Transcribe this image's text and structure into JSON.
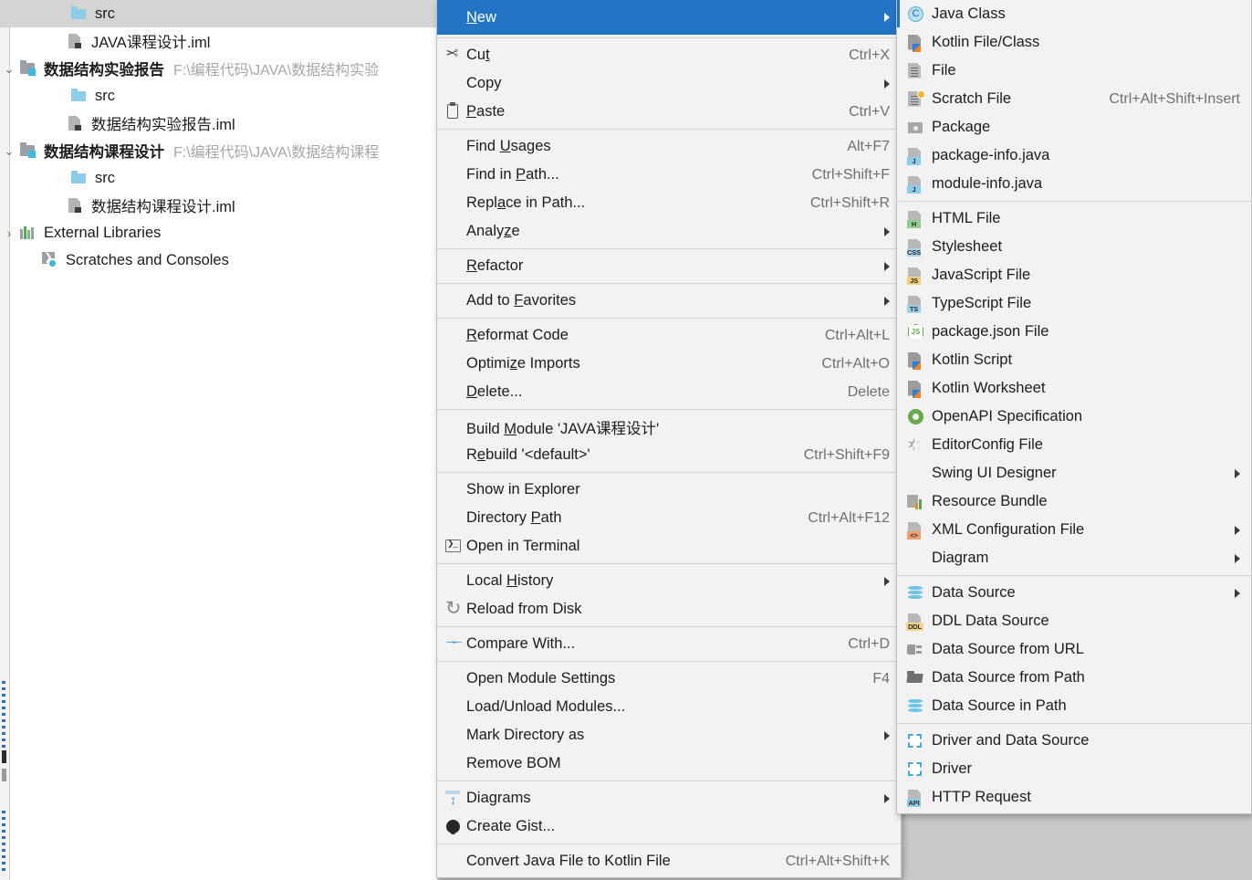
{
  "tree": {
    "rows": [
      {
        "arrow": "",
        "icon": "folder",
        "label": "src",
        "bold": false,
        "path": "",
        "selected": true,
        "indent": 76
      },
      {
        "arrow": "",
        "icon": "iml",
        "label": "JAVA课程设计.iml",
        "bold": false,
        "path": "",
        "selected": false,
        "indent": 72
      },
      {
        "arrow": "⌄",
        "icon": "module",
        "label": "数据结构实验报告",
        "bold": true,
        "path": "F:\\编程代码\\JAVA\\数据结构实验",
        "selected": false,
        "indent": 20
      },
      {
        "arrow": "",
        "icon": "folder",
        "label": "src",
        "bold": false,
        "path": "",
        "selected": false,
        "indent": 76
      },
      {
        "arrow": "",
        "icon": "iml",
        "label": "数据结构实验报告.iml",
        "bold": false,
        "path": "",
        "selected": false,
        "indent": 72
      },
      {
        "arrow": "⌄",
        "icon": "module",
        "label": "数据结构课程设计",
        "bold": true,
        "path": "F:\\编程代码\\JAVA\\数据结构课程",
        "selected": false,
        "indent": 20
      },
      {
        "arrow": "",
        "icon": "folder",
        "label": "src",
        "bold": false,
        "path": "",
        "selected": false,
        "indent": 76
      },
      {
        "arrow": "",
        "icon": "iml",
        "label": "数据结构课程设计.iml",
        "bold": false,
        "path": "",
        "selected": false,
        "indent": 72
      },
      {
        "arrow": "›",
        "icon": "libs",
        "label": "External Libraries",
        "bold": false,
        "path": "",
        "selected": false,
        "indent": 20
      },
      {
        "arrow": "",
        "icon": "scratch",
        "label": "Scratches and Consoles",
        "bold": false,
        "path": "",
        "selected": false,
        "indent": 44
      }
    ]
  },
  "context_menu": {
    "items": [
      {
        "type": "item",
        "icon": "none",
        "label": "New",
        "mnemonic": "N",
        "shortcut": "",
        "submenu": true,
        "highlighted": true
      },
      {
        "type": "sep"
      },
      {
        "type": "item",
        "icon": "cut",
        "label": "Cut",
        "mnemonic": "t",
        "shortcut": "Ctrl+X",
        "submenu": false,
        "highlighted": false
      },
      {
        "type": "item",
        "icon": "none",
        "label": "Copy",
        "mnemonic": "",
        "shortcut": "",
        "submenu": true,
        "highlighted": false
      },
      {
        "type": "item",
        "icon": "paste",
        "label": "Paste",
        "mnemonic": "P",
        "shortcut": "Ctrl+V",
        "submenu": false,
        "highlighted": false
      },
      {
        "type": "sep"
      },
      {
        "type": "item",
        "icon": "none",
        "label": "Find Usages",
        "mnemonic": "U",
        "shortcut": "Alt+F7",
        "submenu": false,
        "highlighted": false
      },
      {
        "type": "item",
        "icon": "none",
        "label": "Find in Path...",
        "mnemonic": "P",
        "shortcut": "Ctrl+Shift+F",
        "submenu": false,
        "highlighted": false
      },
      {
        "type": "item",
        "icon": "none",
        "label": "Replace in Path...",
        "mnemonic": "a",
        "shortcut": "Ctrl+Shift+R",
        "submenu": false,
        "highlighted": false
      },
      {
        "type": "item",
        "icon": "none",
        "label": "Analyze",
        "mnemonic": "z",
        "shortcut": "",
        "submenu": true,
        "highlighted": false
      },
      {
        "type": "sep"
      },
      {
        "type": "item",
        "icon": "none",
        "label": "Refactor",
        "mnemonic": "R",
        "shortcut": "",
        "submenu": true,
        "highlighted": false
      },
      {
        "type": "sep"
      },
      {
        "type": "item",
        "icon": "none",
        "label": "Add to Favorites",
        "mnemonic": "F",
        "shortcut": "",
        "submenu": true,
        "highlighted": false
      },
      {
        "type": "sep"
      },
      {
        "type": "item",
        "icon": "none",
        "label": "Reformat Code",
        "mnemonic": "R",
        "shortcut": "Ctrl+Alt+L",
        "submenu": false,
        "highlighted": false
      },
      {
        "type": "item",
        "icon": "none",
        "label": "Optimize Imports",
        "mnemonic": "z",
        "shortcut": "Ctrl+Alt+O",
        "submenu": false,
        "highlighted": false
      },
      {
        "type": "item",
        "icon": "none",
        "label": "Delete...",
        "mnemonic": "D",
        "shortcut": "Delete",
        "submenu": false,
        "highlighted": false
      },
      {
        "type": "sep"
      },
      {
        "type": "item",
        "icon": "none",
        "label": "Build Module 'JAVA课程设计'",
        "mnemonic": "M",
        "shortcut": "",
        "submenu": false,
        "highlighted": false
      },
      {
        "type": "item",
        "icon": "none",
        "label": "Rebuild '<default>'",
        "mnemonic": "e",
        "shortcut": "Ctrl+Shift+F9",
        "submenu": false,
        "highlighted": false
      },
      {
        "type": "sep"
      },
      {
        "type": "item",
        "icon": "none",
        "label": "Show in Explorer",
        "mnemonic": "",
        "shortcut": "",
        "submenu": false,
        "highlighted": false
      },
      {
        "type": "item",
        "icon": "none",
        "label": "Directory Path",
        "mnemonic": "P",
        "shortcut": "Ctrl+Alt+F12",
        "submenu": false,
        "highlighted": false
      },
      {
        "type": "item",
        "icon": "terminal",
        "label": "Open in Terminal",
        "mnemonic": "",
        "shortcut": "",
        "submenu": false,
        "highlighted": false
      },
      {
        "type": "sep"
      },
      {
        "type": "item",
        "icon": "none",
        "label": "Local History",
        "mnemonic": "H",
        "shortcut": "",
        "submenu": true,
        "highlighted": false
      },
      {
        "type": "item",
        "icon": "reload",
        "label": "Reload from Disk",
        "mnemonic": "",
        "shortcut": "",
        "submenu": false,
        "highlighted": false
      },
      {
        "type": "sep"
      },
      {
        "type": "item",
        "icon": "compare",
        "label": "Compare With...",
        "mnemonic": "",
        "shortcut": "Ctrl+D",
        "submenu": false,
        "highlighted": false
      },
      {
        "type": "sep"
      },
      {
        "type": "item",
        "icon": "none",
        "label": "Open Module Settings",
        "mnemonic": "",
        "shortcut": "F4",
        "submenu": false,
        "highlighted": false
      },
      {
        "type": "item",
        "icon": "none",
        "label": "Load/Unload Modules...",
        "mnemonic": "",
        "shortcut": "",
        "submenu": false,
        "highlighted": false
      },
      {
        "type": "item",
        "icon": "none",
        "label": "Mark Directory as",
        "mnemonic": "",
        "shortcut": "",
        "submenu": true,
        "highlighted": false
      },
      {
        "type": "item",
        "icon": "none",
        "label": "Remove BOM",
        "mnemonic": "",
        "shortcut": "",
        "submenu": false,
        "highlighted": false
      },
      {
        "type": "sep"
      },
      {
        "type": "item",
        "icon": "diagrams",
        "label": "Diagrams",
        "mnemonic": "",
        "shortcut": "",
        "submenu": true,
        "highlighted": false
      },
      {
        "type": "item",
        "icon": "gist",
        "label": "Create Gist...",
        "mnemonic": "",
        "shortcut": "",
        "submenu": false,
        "highlighted": false
      },
      {
        "type": "sep"
      },
      {
        "type": "item",
        "icon": "none",
        "label": "Convert Java File to Kotlin File",
        "mnemonic": "",
        "shortcut": "Ctrl+Alt+Shift+K",
        "submenu": false,
        "highlighted": false
      }
    ]
  },
  "new_submenu": {
    "items": [
      {
        "type": "item",
        "icon": "java-class",
        "label": "Java Class",
        "shortcut": "",
        "submenu": false
      },
      {
        "type": "item",
        "icon": "kotlin-file",
        "label": "Kotlin File/Class",
        "shortcut": "",
        "submenu": false
      },
      {
        "type": "item",
        "icon": "file",
        "label": "File",
        "shortcut": "",
        "submenu": false
      },
      {
        "type": "item",
        "icon": "scratch-file",
        "label": "Scratch File",
        "shortcut": "Ctrl+Alt+Shift+Insert",
        "submenu": false
      },
      {
        "type": "item",
        "icon": "package",
        "label": "Package",
        "shortcut": "",
        "submenu": false
      },
      {
        "type": "item",
        "icon": "java-file",
        "label": "package-info.java",
        "shortcut": "",
        "submenu": false
      },
      {
        "type": "item",
        "icon": "java-file",
        "label": "module-info.java",
        "shortcut": "",
        "submenu": false
      },
      {
        "type": "sep"
      },
      {
        "type": "item",
        "icon": "html-file",
        "label": "HTML File",
        "shortcut": "",
        "submenu": false
      },
      {
        "type": "item",
        "icon": "css-file",
        "label": "Stylesheet",
        "shortcut": "",
        "submenu": false
      },
      {
        "type": "item",
        "icon": "js-file",
        "label": "JavaScript File",
        "shortcut": "",
        "submenu": false
      },
      {
        "type": "item",
        "icon": "ts-file",
        "label": "TypeScript File",
        "shortcut": "",
        "submenu": false
      },
      {
        "type": "item",
        "icon": "nodejs",
        "label": "package.json File",
        "shortcut": "",
        "submenu": false
      },
      {
        "type": "item",
        "icon": "kotlin-file",
        "label": "Kotlin Script",
        "shortcut": "",
        "submenu": false
      },
      {
        "type": "item",
        "icon": "kotlin-file",
        "label": "Kotlin Worksheet",
        "shortcut": "",
        "submenu": false
      },
      {
        "type": "item",
        "icon": "openapi",
        "label": "OpenAPI Specification",
        "shortcut": "",
        "submenu": false
      },
      {
        "type": "item",
        "icon": "gear",
        "label": "EditorConfig File",
        "shortcut": "",
        "submenu": false
      },
      {
        "type": "item",
        "icon": "none",
        "label": "Swing UI Designer",
        "shortcut": "",
        "submenu": true
      },
      {
        "type": "item",
        "icon": "bundle",
        "label": "Resource Bundle",
        "shortcut": "",
        "submenu": false
      },
      {
        "type": "item",
        "icon": "xml-file",
        "label": "XML Configuration File",
        "shortcut": "",
        "submenu": true
      },
      {
        "type": "item",
        "icon": "none",
        "label": "Diagram",
        "shortcut": "",
        "submenu": true
      },
      {
        "type": "sep"
      },
      {
        "type": "item",
        "icon": "database",
        "label": "Data Source",
        "shortcut": "",
        "submenu": true
      },
      {
        "type": "item",
        "icon": "ddl",
        "label": "DDL Data Source",
        "shortcut": "",
        "submenu": false
      },
      {
        "type": "item",
        "icon": "plug",
        "label": "Data Source from URL",
        "shortcut": "",
        "submenu": false
      },
      {
        "type": "item",
        "icon": "open-folder",
        "label": "Data Source from Path",
        "shortcut": "",
        "submenu": false
      },
      {
        "type": "item",
        "icon": "database",
        "label": "Data Source in Path",
        "shortcut": "",
        "submenu": false
      },
      {
        "type": "sep"
      },
      {
        "type": "item",
        "icon": "driver",
        "label": "Driver and Data Source",
        "shortcut": "",
        "submenu": false
      },
      {
        "type": "item",
        "icon": "driver",
        "label": "Driver",
        "shortcut": "",
        "submenu": false
      },
      {
        "type": "item",
        "icon": "http-request",
        "label": "HTTP Request",
        "shortcut": "",
        "submenu": false
      }
    ]
  },
  "colors": {
    "menu_bg": "#f2f2f2",
    "highlight": "#2275c4",
    "highlight_text": "#ffffff",
    "desktop_bg": "#c9c9c9",
    "tree_bg": "#ffffff",
    "tree_selection": "#d4d4d4",
    "shortcut_text": "#6f6f6f",
    "path_text": "#a7a7a7",
    "separator": "#d4d4d4"
  }
}
